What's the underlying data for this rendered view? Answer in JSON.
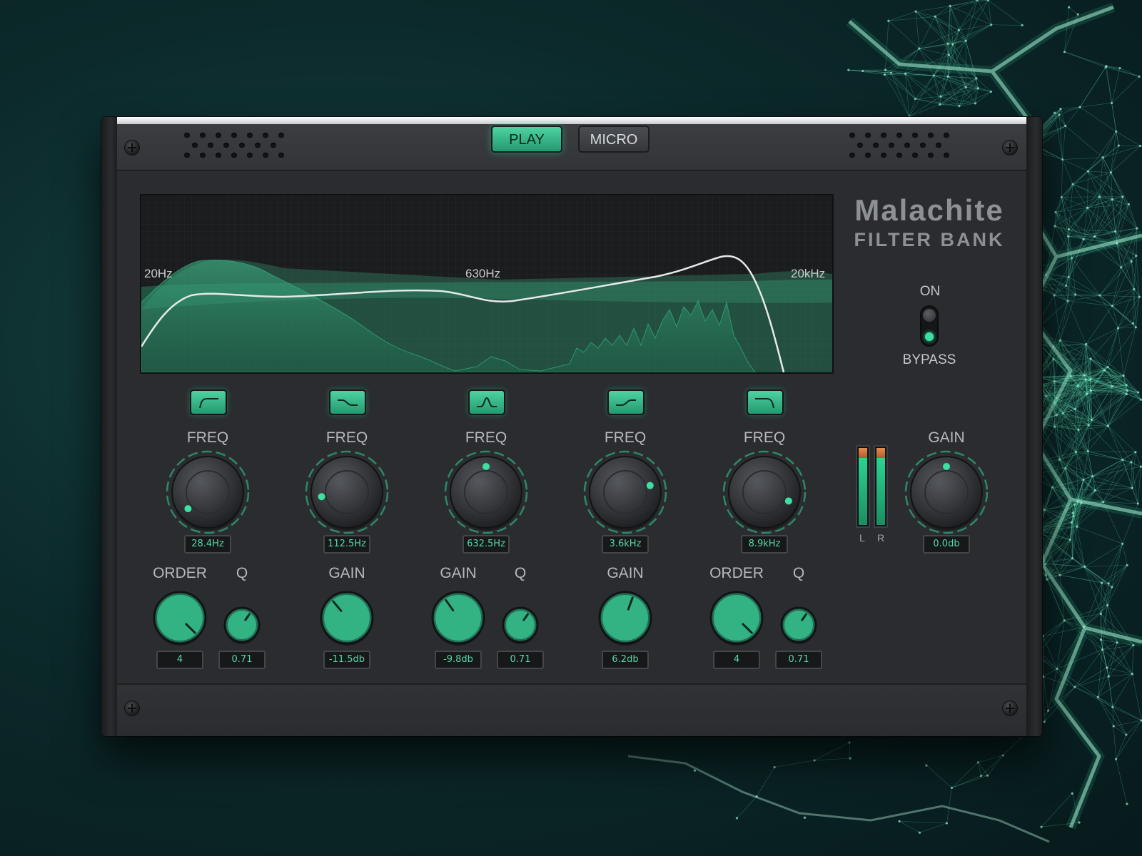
{
  "header": {
    "play_label": "PLAY",
    "micro_label": "MICRO"
  },
  "brand": {
    "title": "Malachite",
    "subtitle": "FILTER BANK"
  },
  "display": {
    "freq_labels": [
      "20Hz",
      "630Hz",
      "20kHz"
    ]
  },
  "power": {
    "on_label": "ON",
    "bypass_label": "BYPASS",
    "state": "BYPASS"
  },
  "bands": [
    {
      "type_icon": "highpass-filter-icon",
      "freq_label": "FREQ",
      "freq_value": "28.4Hz",
      "sub": [
        {
          "label": "ORDER",
          "value": "4"
        },
        {
          "label": "Q",
          "value": "0.71"
        }
      ]
    },
    {
      "type_icon": "low-shelf-filter-icon",
      "freq_label": "FREQ",
      "freq_value": "112.5Hz",
      "sub": [
        {
          "label": "GAIN",
          "value": "-11.5db"
        }
      ]
    },
    {
      "type_icon": "bell-filter-icon",
      "freq_label": "FREQ",
      "freq_value": "632.5Hz",
      "sub": [
        {
          "label": "GAIN",
          "value": "-9.8db"
        },
        {
          "label": "Q",
          "value": "0.71"
        }
      ]
    },
    {
      "type_icon": "high-shelf-filter-icon",
      "freq_label": "FREQ",
      "freq_value": "3.6kHz",
      "sub": [
        {
          "label": "GAIN",
          "value": "6.2db"
        }
      ]
    },
    {
      "type_icon": "lowpass-filter-icon",
      "freq_label": "FREQ",
      "freq_value": "8.9kHz",
      "sub": [
        {
          "label": "ORDER",
          "value": "4"
        },
        {
          "label": "Q",
          "value": "0.71"
        }
      ]
    }
  ],
  "output": {
    "gain_label": "GAIN",
    "gain_value": "0.0db",
    "meter_left_label": "L",
    "meter_right_label": "R"
  },
  "colors": {
    "accent": "#3be0a2",
    "panel": "#2a2c2f",
    "value_text": "#58d6a6"
  }
}
